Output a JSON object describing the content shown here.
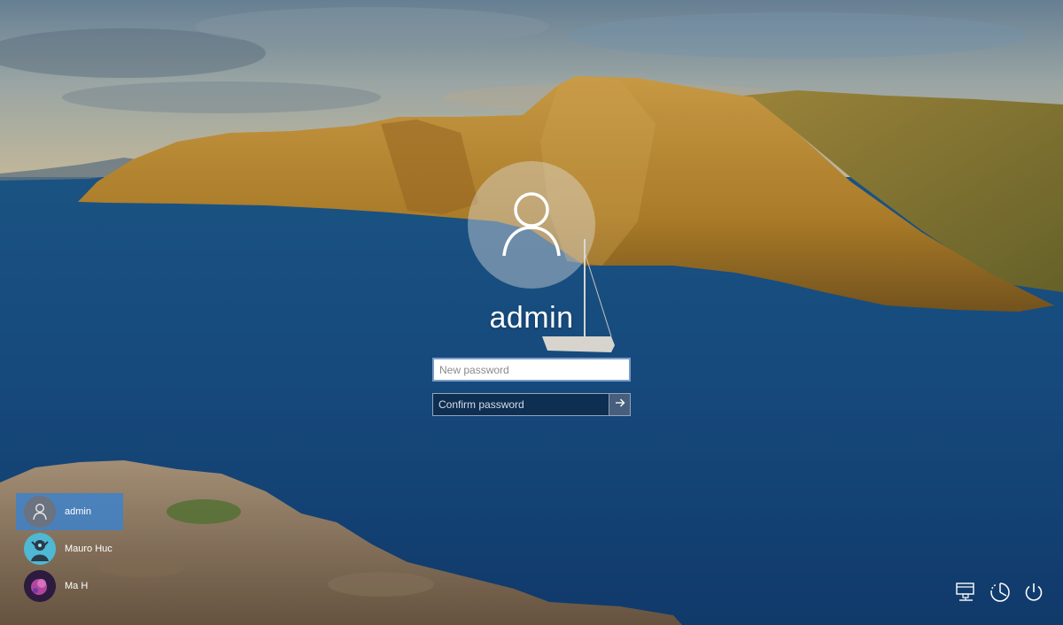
{
  "login": {
    "username": "admin",
    "new_password_placeholder": "New password",
    "confirm_password_placeholder": "Confirm password",
    "avatar_icon": "user-silhouette-icon",
    "submit_icon": "arrow-right-icon"
  },
  "users": [
    {
      "name": "admin",
      "avatar": "user-silhouette-icon",
      "selected": true
    },
    {
      "name": "Mauro Huc",
      "avatar": "photo-avatar",
      "selected": false
    },
    {
      "name": "Ma H",
      "avatar": "photo-avatar",
      "selected": false
    }
  ],
  "system_icons": [
    "network-icon",
    "ease-of-access-icon",
    "power-icon"
  ],
  "colors": {
    "selected_user_bg": "#3c82cd",
    "text": "#ffffff"
  }
}
